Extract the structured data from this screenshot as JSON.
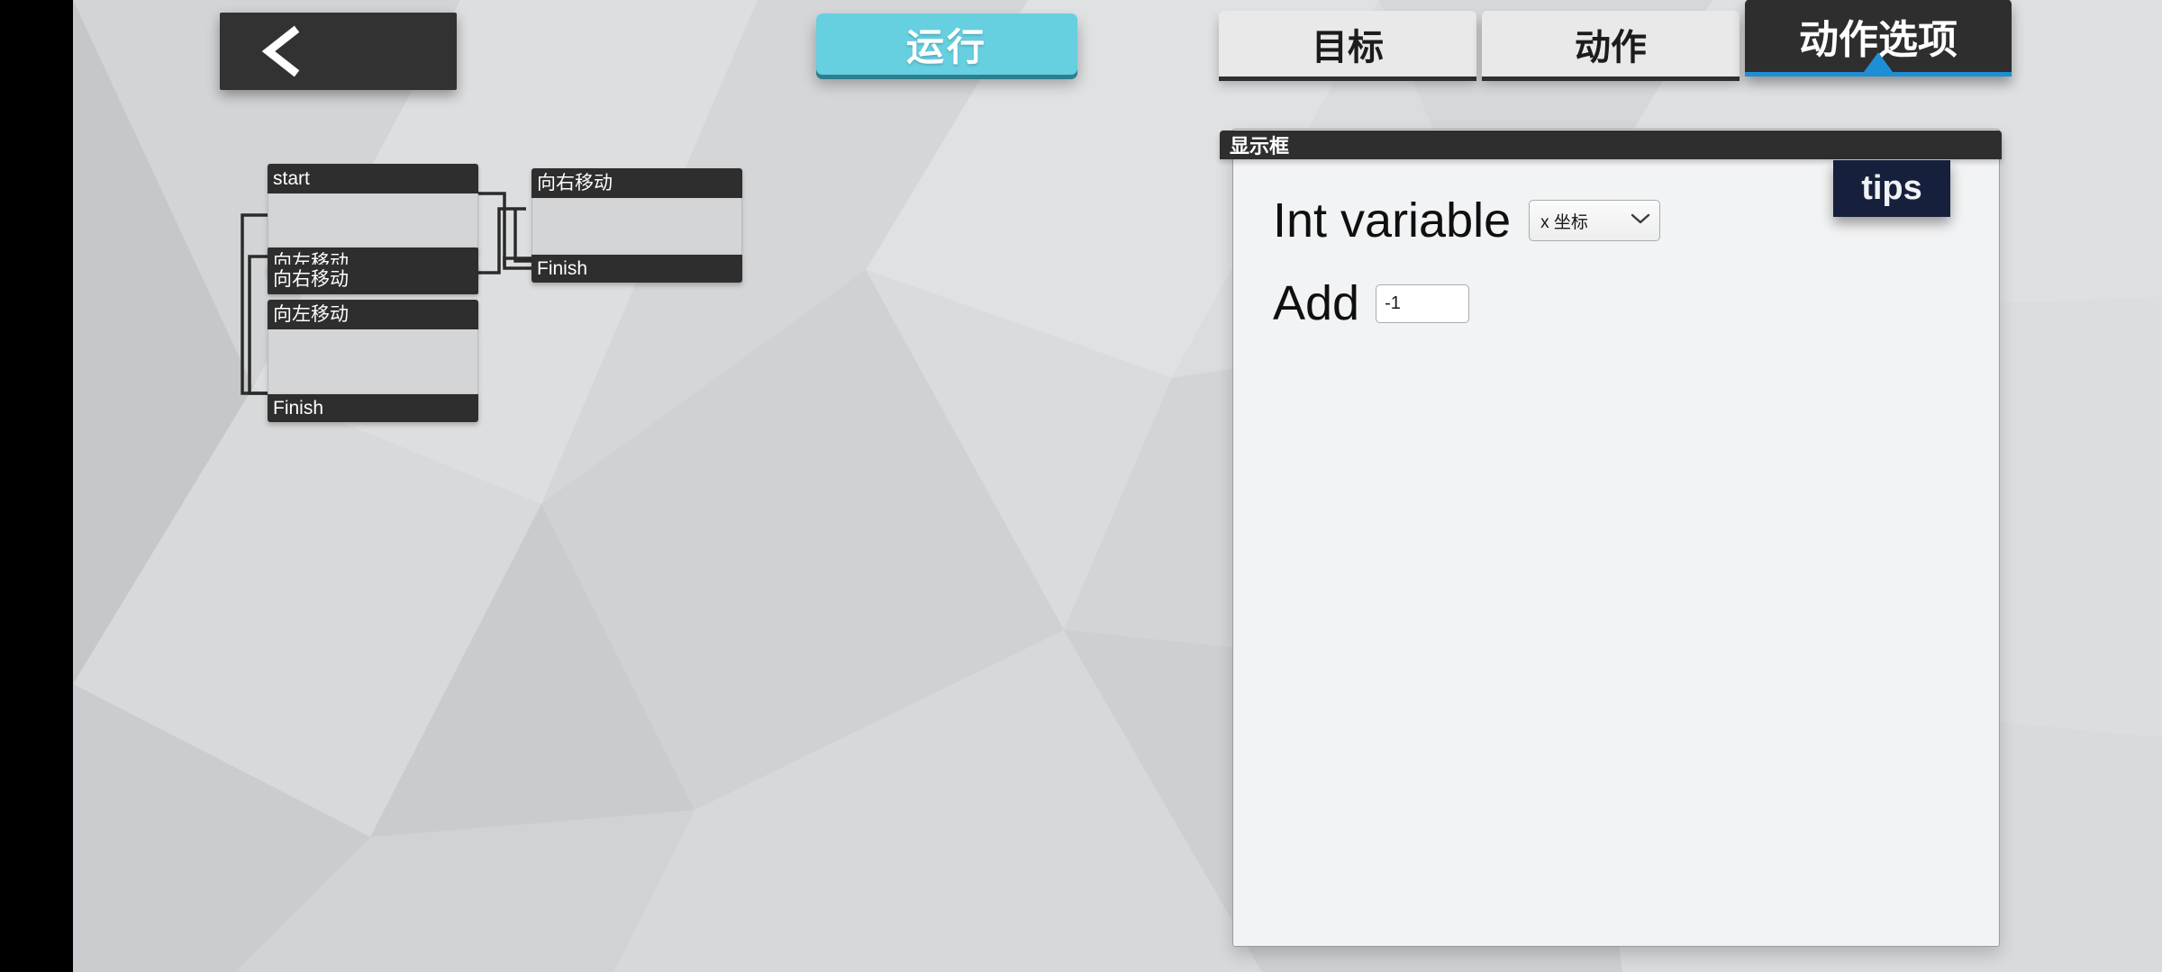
{
  "toolbar": {
    "back_label": "chevron-left",
    "run_label": "运行"
  },
  "tabs": [
    {
      "label": "目标",
      "active": false
    },
    {
      "label": "动作",
      "active": false
    },
    {
      "label": "动作选项",
      "active": true
    }
  ],
  "panel": {
    "title": "显示框",
    "fields": [
      {
        "label": "Int variable",
        "control": "select",
        "value": "x 坐标"
      },
      {
        "label": "Add",
        "control": "input",
        "value": "-1"
      }
    ]
  },
  "tips": {
    "label": "tips"
  },
  "flowchart": {
    "nodes": [
      {
        "id": "start",
        "header": "start",
        "footer": "",
        "type": "block"
      },
      {
        "id": "left-bar-1",
        "header": "向左移动",
        "footer": "",
        "type": "bar"
      },
      {
        "id": "right-bar-1",
        "header": "向右移动",
        "footer": "",
        "type": "bar"
      },
      {
        "id": "left-block",
        "header": "向左移动",
        "footer": "Finish",
        "type": "block"
      },
      {
        "id": "right-block",
        "header": "向右移动",
        "footer": "Finish",
        "type": "block"
      }
    ]
  },
  "colors": {
    "accent_run": "#66cfe0",
    "accent_tab": "#1e8fd5",
    "tips_bg": "#16203c",
    "node_header": "#2e2e2e",
    "node_body": "#d3d5d6",
    "background": "#c9cbcd"
  }
}
